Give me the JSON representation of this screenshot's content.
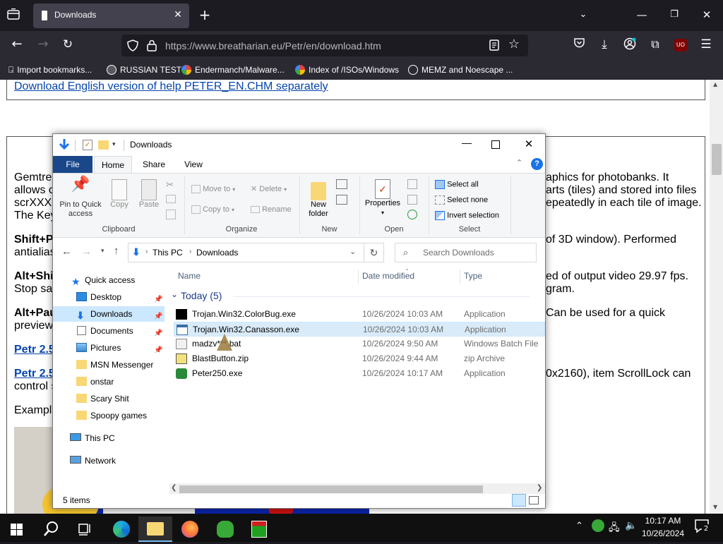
{
  "browser": {
    "tab_title": "Downloads",
    "url": "https://www.breatharian.eu/Petr/en/download.htm",
    "bookmarks": [
      {
        "label": "Import bookmarks...",
        "icon": "import-icon"
      },
      {
        "label": "RUSSIAN TEST",
        "icon": "globe-icon"
      },
      {
        "label": "Endermanch/Malware...",
        "icon": "google-icon"
      },
      {
        "label": "Index of /ISOs/Windows",
        "icon": "google-icon"
      },
      {
        "label": "MEMZ and Noescape ...",
        "icon": "globe-icon"
      }
    ],
    "ublock_badge": "UO"
  },
  "webpage": {
    "link_top": "Download English version of help PETER_EN.CHM separately",
    "para1_left": "Gemtre",
    "para1_right": "aphics for photobanks. It",
    "para2_left": "allows c",
    "para2_right": "arts (tiles) and stored into files",
    "para3_left": "scrXXX",
    "para3_right": "epeatedly in each tile of image.",
    "para4_left": "The Key",
    "shift_left": "Shift+P",
    "shift_right": "of 3D window). Performed",
    "antialias_left": "antialias",
    "altshi_left": "Alt+Shi",
    "altshi_right": "ed of output video 29.97 fps.",
    "stop_left": "Stop sa",
    "stop_right": "gram.",
    "altpau_left": "Alt+Pau",
    "altpau_right": "Can be used for a quick",
    "preview_left": "preview",
    "petr1_left": "Petr 2.5",
    "petr2_left": "Petr 2.5",
    "petr2_right": "0x2160), item ScrollLock can",
    "control_left": "control s",
    "example_left": "Exampl"
  },
  "explorer": {
    "title": "Downloads",
    "tabs": [
      "File",
      "Home",
      "Share",
      "View"
    ],
    "ribbon": {
      "pin": "Pin to Quick access",
      "copy": "Copy",
      "paste": "Paste",
      "move_to": "Move to",
      "copy_to": "Copy to",
      "delete": "Delete",
      "rename": "Rename",
      "new_folder": "New folder",
      "properties": "Properties",
      "select_all": "Select all",
      "select_none": "Select none",
      "invert_selection": "Invert selection",
      "groups": [
        "Clipboard",
        "Organize",
        "New",
        "Open",
        "Select"
      ]
    },
    "breadcrumb": [
      "This PC",
      "Downloads"
    ],
    "search_placeholder": "Search Downloads",
    "nav": {
      "quick_access": "Quick access",
      "items": [
        {
          "label": "Desktop",
          "pinned": true
        },
        {
          "label": "Downloads",
          "pinned": true,
          "selected": true
        },
        {
          "label": "Documents",
          "pinned": true
        },
        {
          "label": "Pictures",
          "pinned": true
        },
        {
          "label": "MSN Messenger"
        },
        {
          "label": "onstar"
        },
        {
          "label": "Scary Shit"
        },
        {
          "label": "Spoopy games"
        }
      ],
      "this_pc": "This PC",
      "network": "Network"
    },
    "columns": {
      "name": "Name",
      "date": "Date modified",
      "type": "Type"
    },
    "group_label": "Today (5)",
    "files": [
      {
        "name": "Trojan.Win32.ColorBug.exe",
        "date": "10/26/2024 10:03 AM",
        "type": "Application",
        "icon": "black-app-icon"
      },
      {
        "name": "Trojan.Win32.Canasson.exe",
        "date": "10/26/2024 10:03 AM",
        "type": "Application",
        "icon": "app-window-icon",
        "selected": true
      },
      {
        "name": "madzv***.bat",
        "date": "10/26/2024 9:50 AM",
        "type": "Windows Batch File",
        "icon": "batch-file-icon"
      },
      {
        "name": "BlastButton.zip",
        "date": "10/26/2024 9:44 AM",
        "type": "zip Archive",
        "icon": "zip-icon"
      },
      {
        "name": "Peter250.exe",
        "date": "10/26/2024 10:17 AM",
        "type": "Application",
        "icon": "green-app-icon"
      }
    ],
    "status": "5 items"
  },
  "taskbar": {
    "time": "10:17 AM",
    "date": "10/26/2024",
    "notifications": "2"
  }
}
